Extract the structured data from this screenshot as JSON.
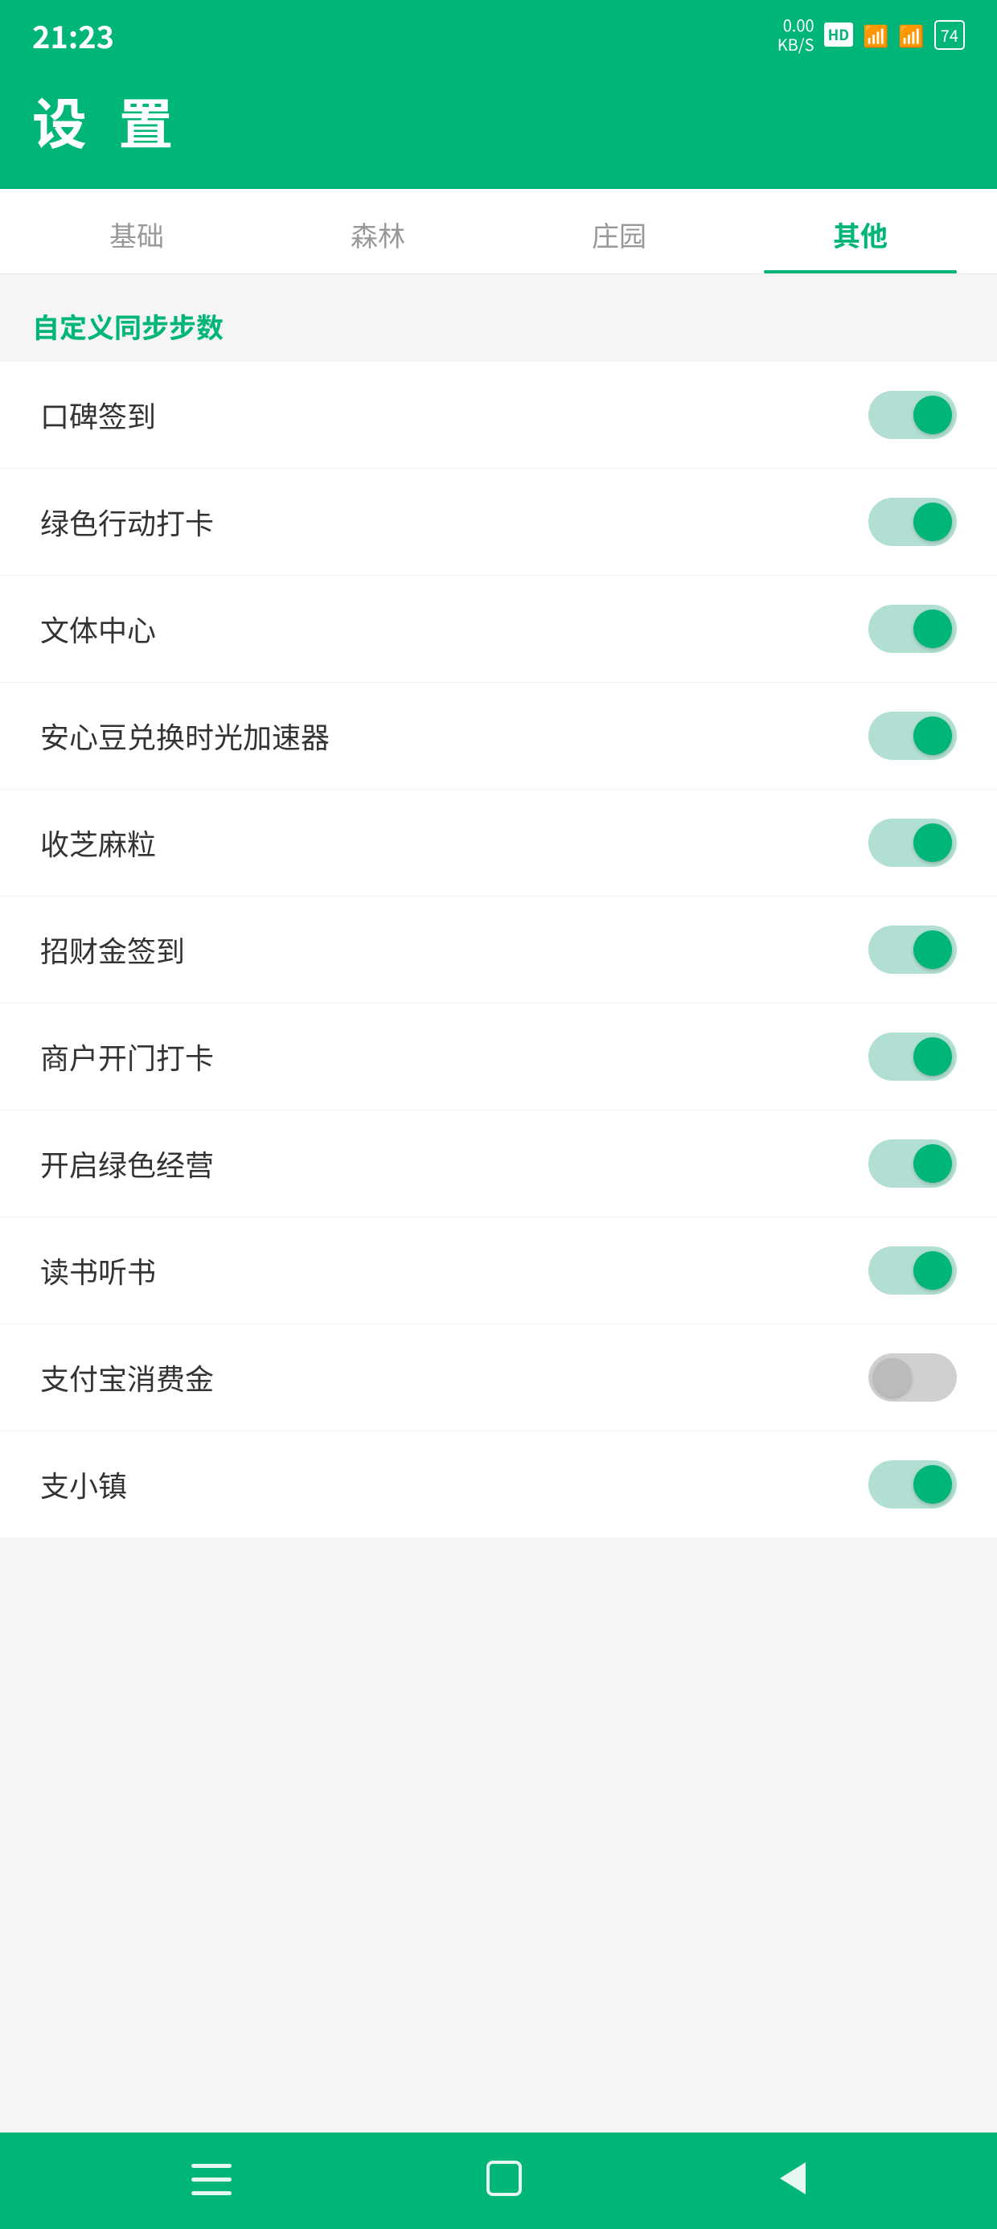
{
  "statusBar": {
    "time": "21:23",
    "network": "0.00\nKB/S",
    "hd": "HD",
    "signal1": "5G",
    "signal2": "5G",
    "battery": "74"
  },
  "header": {
    "title": "设 置"
  },
  "tabs": [
    {
      "id": "basic",
      "label": "基础",
      "active": false
    },
    {
      "id": "forest",
      "label": "森林",
      "active": false
    },
    {
      "id": "farm",
      "label": "庄园",
      "active": false
    },
    {
      "id": "other",
      "label": "其他",
      "active": true
    }
  ],
  "sectionTitle": "自定义同步步数",
  "settings": [
    {
      "id": "koubei",
      "label": "口碑签到",
      "on": true
    },
    {
      "id": "green",
      "label": "绿色行动打卡",
      "on": true
    },
    {
      "id": "sports",
      "label": "文体中心",
      "on": true
    },
    {
      "id": "anxin",
      "label": "安心豆兑换时光加速器",
      "on": true
    },
    {
      "id": "zhima",
      "label": "收芝麻粒",
      "on": true
    },
    {
      "id": "zhaocai",
      "label": "招财金签到",
      "on": true
    },
    {
      "id": "merchant",
      "label": "商户开门打卡",
      "on": true
    },
    {
      "id": "greenop",
      "label": "开启绿色经营",
      "on": true
    },
    {
      "id": "reading",
      "label": "读书听书",
      "on": true
    },
    {
      "id": "alipay",
      "label": "支付宝消费金",
      "on": false
    },
    {
      "id": "zhizhen",
      "label": "支小镇",
      "on": true
    }
  ],
  "bottomNav": {
    "menu": "≡",
    "home": "⬜",
    "back": "◁"
  }
}
